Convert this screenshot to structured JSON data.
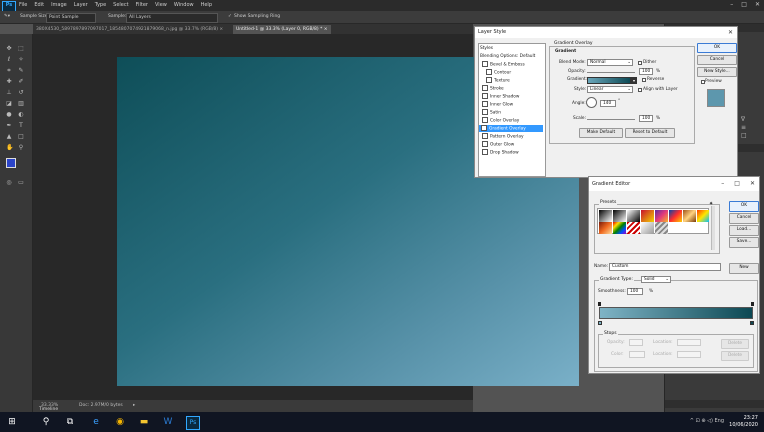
{
  "app": {
    "logo": "Ps",
    "menus": [
      "File",
      "Edit",
      "Image",
      "Layer",
      "Type",
      "Select",
      "Filter",
      "View",
      "Window",
      "Help"
    ],
    "window_controls": [
      "–",
      "□",
      "✕"
    ]
  },
  "options_bar": {
    "sample_size_label": "Sample Size:",
    "sample_size_value": "Point Sample",
    "sample_label": "Sample:",
    "sample_value": "All Layers",
    "show_ring_label": "Show Sampling Ring"
  },
  "doc_tabs": [
    {
      "label": "380X4530_5897897897097017_1854807074921879068_n.jpg @ 33.7% (RGB/8) ×"
    },
    {
      "label": "Untitled-1 @ 33.3% (Layer 0, RGB/8) * ×"
    }
  ],
  "status_bar": {
    "zoom": "33.33%",
    "doc_info": "Doc: 2.97M/0 bytes",
    "timeline": "Timeline"
  },
  "layer_style": {
    "title": "Layer Style",
    "styles_header": "Styles",
    "styles": [
      {
        "label": "Blending Options: Default",
        "check": false,
        "selected": false
      },
      {
        "label": "Bevel & Emboss",
        "check": true,
        "selected": false
      },
      {
        "label": "Contour",
        "check": true,
        "selected": false,
        "indent": true
      },
      {
        "label": "Texture",
        "check": true,
        "selected": false,
        "indent": true
      },
      {
        "label": "Stroke",
        "check": true,
        "selected": false
      },
      {
        "label": "Inner Shadow",
        "check": true,
        "selected": false
      },
      {
        "label": "Inner Glow",
        "check": true,
        "selected": false
      },
      {
        "label": "Satin",
        "check": true,
        "selected": false
      },
      {
        "label": "Color Overlay",
        "check": true,
        "selected": false
      },
      {
        "label": "Gradient Overlay",
        "check": true,
        "selected": true
      },
      {
        "label": "Pattern Overlay",
        "check": true,
        "selected": false
      },
      {
        "label": "Outer Glow",
        "check": true,
        "selected": false
      },
      {
        "label": "Drop Shadow",
        "check": true,
        "selected": false
      }
    ],
    "section_title": "Gradient Overlay",
    "sub_title": "Gradient",
    "blend_mode_label": "Blend Mode:",
    "blend_mode_value": "Normal",
    "dither_label": "Dither",
    "opacity_label": "Opacity:",
    "opacity_value": "100",
    "percent": "%",
    "gradient_label": "Gradient:",
    "reverse_label": "Reverse",
    "style_label": "Style:",
    "style_value": "Linear",
    "align_label": "Align with Layer",
    "angle_label": "Angle:",
    "angle_value": "140",
    "degree": "°",
    "scale_label": "Scale:",
    "scale_value": "100",
    "make_default": "Make Default",
    "reset_default": "Reset to Default",
    "ok": "OK",
    "cancel": "Cancel",
    "new_style": "New Style...",
    "preview_label": "Preview",
    "close": "✕"
  },
  "gradient_editor": {
    "title": "Gradient Editor",
    "presets_label": "Presets",
    "ok": "OK",
    "cancel": "Cancel",
    "load": "Load...",
    "save": "Save...",
    "name_label": "Name:",
    "name_value": "Custom",
    "new_button": "New",
    "gradient_type_label": "Gradient Type:",
    "gradient_type_value": "Solid",
    "smoothness_label": "Smoothness:",
    "smoothness_value": "100",
    "percent": "%",
    "stops_label": "Stops",
    "opacity_label": "Opacity:",
    "location_label": "Location:",
    "color_label": "Color:",
    "delete_label": "Delete",
    "ctl": [
      "–",
      "□",
      "✕"
    ]
  },
  "taskbar": {
    "time": "23:27",
    "date": "10/06/2020",
    "tray": "^  ⊡  ⊕  ◁)  Eng"
  },
  "colors": {
    "ps_blue": "#31a8ff",
    "gradient_dark": "#0e4e58",
    "gradient_light": "#7ab0c8",
    "selection": "#3399ff"
  }
}
